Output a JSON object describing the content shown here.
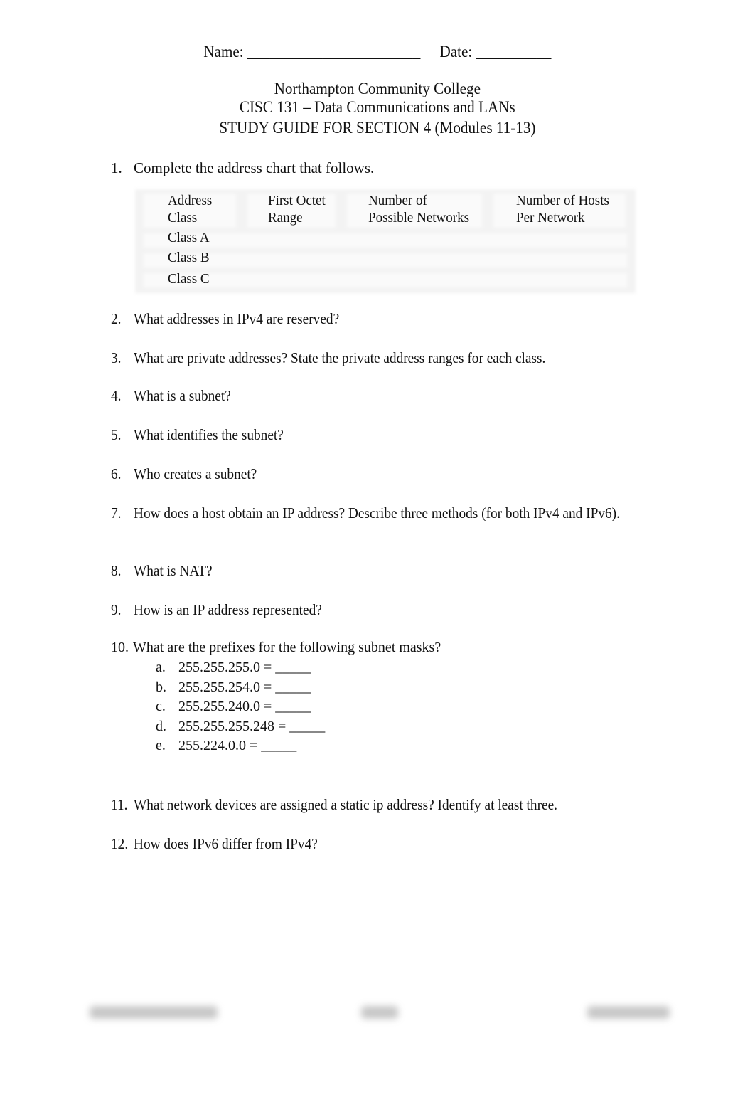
{
  "header": {
    "name_label": "Name:",
    "name_blank": "_______________________",
    "date_label": "Date:",
    "date_blank": "__________"
  },
  "title": {
    "institution": "Northampton Community College",
    "course": "CISC 131 – Data Communications and LANs",
    "guide": "STUDY GUIDE FOR SECTION 4 (Modules 11-13)"
  },
  "address_table": {
    "headers": [
      [
        "Address",
        "Class"
      ],
      [
        "First Octet",
        "Range"
      ],
      [
        "Number of",
        "Possible Networks"
      ],
      [
        "Number of Hosts",
        "Per Network"
      ]
    ],
    "rows": [
      [
        "Class A",
        "",
        "",
        ""
      ],
      [
        "Class B",
        "",
        "",
        ""
      ],
      [
        "Class C",
        "",
        "",
        ""
      ]
    ]
  },
  "questions": [
    {
      "number": "1.",
      "text": "Complete the address chart that follows."
    },
    {
      "number": "2.",
      "text": "What addresses in IPv4 are reserved?"
    },
    {
      "number": "3.",
      "text": "What are private addresses? State the private address ranges for each class."
    },
    {
      "number": "4.",
      "text": "What is a subnet?"
    },
    {
      "number": "5.",
      "text": "What identifies the subnet?"
    },
    {
      "number": "6.",
      "text": "Who creates a subnet?"
    },
    {
      "number": "7.",
      "text": "How does a host obtain an IP address? Describe three methods (for both IPv4 and IPv6)."
    },
    {
      "number": "8.",
      "text": "What is NAT?"
    },
    {
      "number": "9.",
      "text": "How is an IP address represented?"
    },
    {
      "number": "10.",
      "text": "What are the prefixes for the following subnet masks?"
    },
    {
      "number": "11.",
      "text": "What network devices are assigned a static ip address? Identify at least three."
    },
    {
      "number": "12.",
      "text": "How does IPv6 differ from IPv4?"
    }
  ],
  "subnet_masks": [
    {
      "letter": "a.",
      "text": "255.255.255.0 = _____"
    },
    {
      "letter": "b.",
      "text": "255.255.254.0 = _____"
    },
    {
      "letter": "c.",
      "text": "255.255.240.0 = _____"
    },
    {
      "letter": "d.",
      "text": "255.255.255.248 = _____"
    },
    {
      "letter": "e.",
      "text": "255.224.0.0 = _____"
    }
  ]
}
